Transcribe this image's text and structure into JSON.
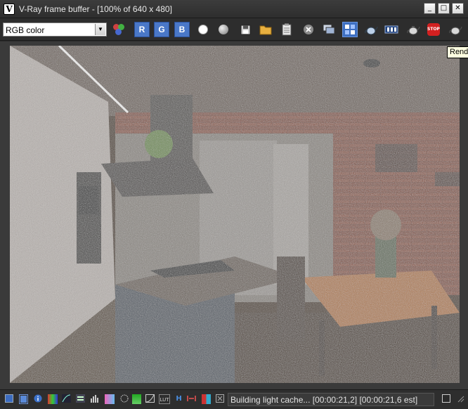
{
  "window": {
    "title": "V-Ray frame buffer - [100% of 640 x 480]",
    "minimize_glyph": "_",
    "maximize_glyph": "□",
    "close_glyph": "✕"
  },
  "toolbar": {
    "channel_value": "RGB color",
    "channel_options": [
      "RGB color"
    ],
    "red_label": "R",
    "green_label": "G",
    "blue_label": "B",
    "stop_label": "STOP",
    "tooltip": "Rend",
    "icons": [
      "color-clamp-icon",
      "red-channel",
      "green-channel",
      "blue-channel",
      "white-circle-icon",
      "gray-circle-icon",
      "save-image-icon",
      "load-image-icon",
      "clipboard-icon",
      "clear-image-icon",
      "vfb-history-icon",
      "track-mouse-icon",
      "render-region-icon",
      "lut-icon",
      "teapot-render-icon",
      "stop-render-icon",
      "interactive-render-icon"
    ]
  },
  "statusbar": {
    "status_text": "Building light cache... [00:00:21,2] [00:00:21,6 est]",
    "icons": [
      "sidebar-icon",
      "color-correction-icon",
      "info-icon",
      "levels-icon",
      "curves-icon",
      "exposure-icon",
      "histogram-icon",
      "white-balance-icon",
      "hsl-icon",
      "color-balance-icon",
      "lut-icon",
      "curves-box-icon",
      "lens-effects-icon",
      "test-resolution-icon",
      "compare-icon",
      "stereo-icon"
    ],
    "lut_label": "LUT",
    "h_label": "H"
  },
  "render": {
    "width": 640,
    "height": 480,
    "zoom": "100%"
  },
  "colors": {
    "title_bg": "#333333",
    "toolbar_bg": "#2d2d2d",
    "channel_button": "#4a78c8",
    "stop_red": "#d32020"
  }
}
